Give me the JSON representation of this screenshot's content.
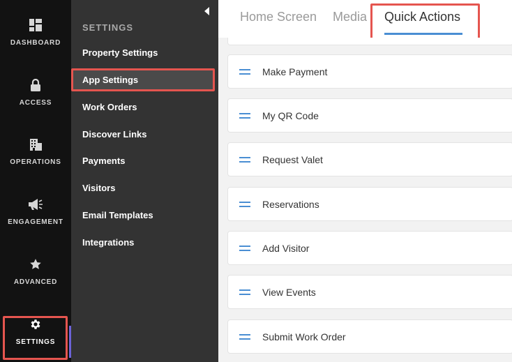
{
  "rail": {
    "items": [
      {
        "label": "DASHBOARD",
        "icon": "dashboard-icon"
      },
      {
        "label": "ACCESS",
        "icon": "lock-icon"
      },
      {
        "label": "OPERATIONS",
        "icon": "building-icon"
      },
      {
        "label": "ENGAGEMENT",
        "icon": "megaphone-icon"
      },
      {
        "label": "ADVANCED",
        "icon": "star-icon"
      },
      {
        "label": "SETTINGS",
        "icon": "gear-icon"
      }
    ],
    "active": "SETTINGS"
  },
  "submenu": {
    "title": "SETTINGS",
    "items": [
      {
        "label": "Property Settings"
      },
      {
        "label": "App Settings"
      },
      {
        "label": "Work Orders"
      },
      {
        "label": "Discover Links"
      },
      {
        "label": "Payments"
      },
      {
        "label": "Visitors"
      },
      {
        "label": "Email Templates"
      },
      {
        "label": "Integrations"
      }
    ],
    "active": "App Settings"
  },
  "tabs": {
    "items": [
      {
        "label": "Home Screen"
      },
      {
        "label": "Media"
      },
      {
        "label": "Quick Actions"
      }
    ],
    "active": "Quick Actions"
  },
  "quick_actions": [
    {
      "label": "Make Payment"
    },
    {
      "label": "My QR Code"
    },
    {
      "label": "Request Valet"
    },
    {
      "label": "Reservations"
    },
    {
      "label": "Add Visitor"
    },
    {
      "label": "View Events"
    },
    {
      "label": "Submit Work Order"
    }
  ],
  "colors": {
    "highlight": "#e5554f",
    "accent": "#4a8ed3",
    "rail_bg": "#121212",
    "submenu_bg": "#333333"
  }
}
